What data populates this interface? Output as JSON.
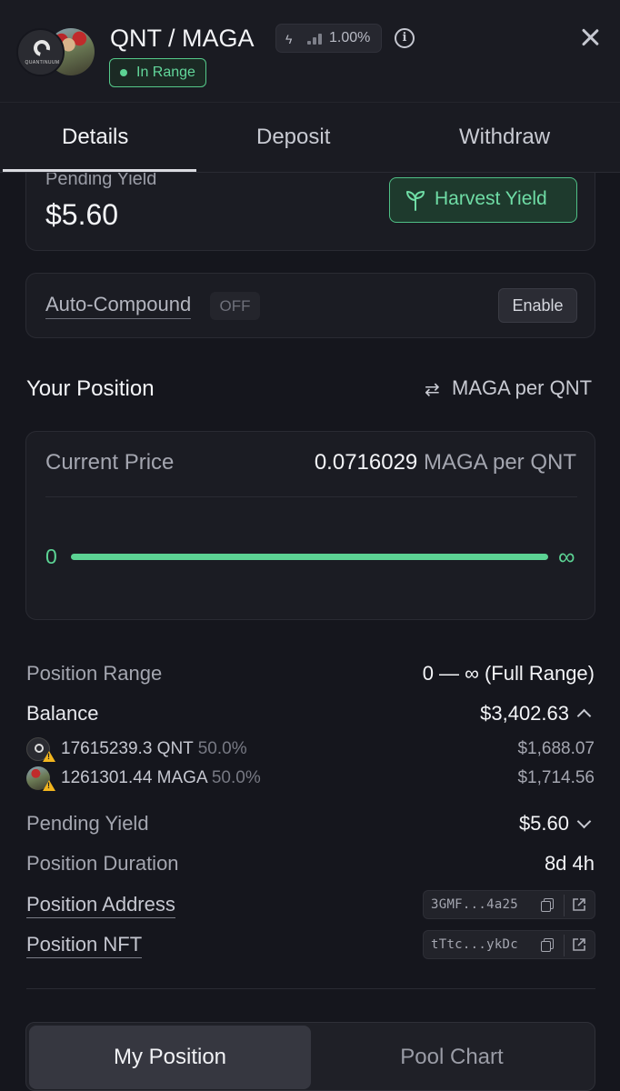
{
  "header": {
    "pair_title": "QNT / MAGA",
    "qnt_logo_text": "QUANTINUUM",
    "fee_tier": "1.00%",
    "status_badge": "In Range",
    "icons": [
      "bolt-icon",
      "signal-bars-icon",
      "info-icon",
      "close-icon"
    ]
  },
  "tabs": {
    "items": [
      {
        "label": "Details",
        "active": true
      },
      {
        "label": "Deposit",
        "active": false
      },
      {
        "label": "Withdraw",
        "active": false
      }
    ]
  },
  "yield_card": {
    "label": "Pending Yield",
    "value": "$5.60",
    "harvest_label": "Harvest Yield"
  },
  "auto_compound": {
    "label": "Auto-Compound",
    "status": "OFF",
    "enable_label": "Enable"
  },
  "position": {
    "title": "Your Position",
    "toggle_label": "MAGA per QNT",
    "current_price_label": "Current Price",
    "current_price_value": "0.0716029",
    "current_price_unit": "MAGA per QNT",
    "range_min": "0",
    "range_max": "∞"
  },
  "details": {
    "position_range_label": "Position Range",
    "position_range_value": "0 — ∞ (Full Range)",
    "balance_label": "Balance",
    "balance_value": "$3,402.63",
    "tokens": [
      {
        "amount": "17615239.3 QNT",
        "share": "50.0%",
        "usd": "$1,688.07"
      },
      {
        "amount": "1261301.44 MAGA",
        "share": "50.0%",
        "usd": "$1,714.56"
      }
    ],
    "pending_yield_label": "Pending Yield",
    "pending_yield_value": "$5.60",
    "duration_label": "Position Duration",
    "duration_value": "8d 4h",
    "address_label": "Position Address",
    "address_value": "3GMF...4a25",
    "nft_label": "Position NFT",
    "nft_value": "tTtc...ykDc"
  },
  "bottom_toggle": {
    "my_position": "My Position",
    "pool_chart": "Pool Chart"
  },
  "colors": {
    "background": "#15161d",
    "accent_green": "#5cd394",
    "card": "#1b1c23"
  }
}
